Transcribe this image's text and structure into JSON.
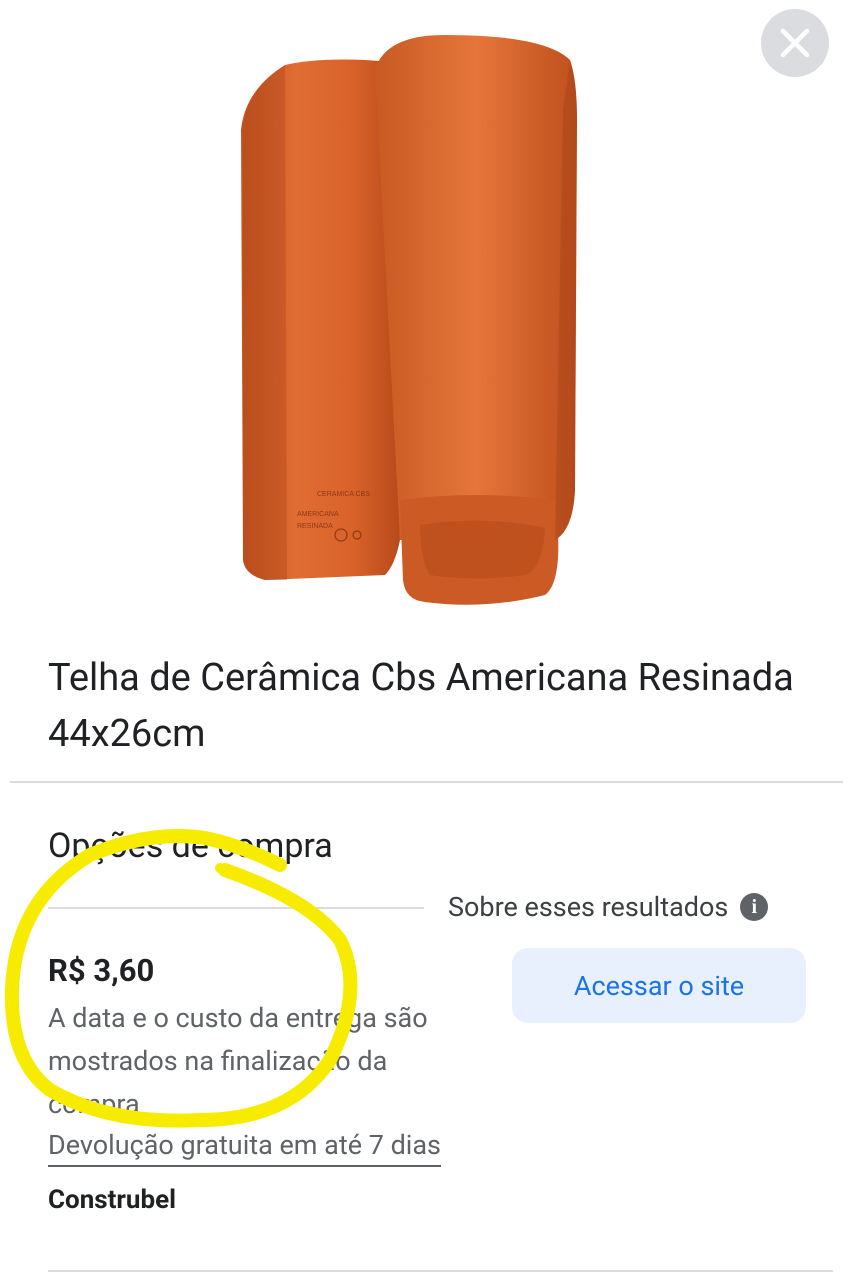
{
  "icons": {
    "close": "close-icon",
    "info": "info-icon"
  },
  "colors": {
    "accent": "#1a73e8",
    "button_bg": "#e8f0fe",
    "tile": "#d4612a",
    "highlight": "#f7ec00"
  },
  "product": {
    "title": "Telha de Cerâmica Cbs Americana Resinada 44x26cm",
    "image_stamp_lines": [
      "CERAMICA CBS",
      "AMERICANA",
      "RESINADA"
    ]
  },
  "purchase": {
    "section_title": "Opções de compra",
    "about_results": "Sobre esses resultados",
    "info_glyph": "i",
    "price": "R$ 3,60",
    "delivery_note": "A data e o custo da entrega são mostrados na finalização da compra",
    "returns": "Devolução gratuita em até 7 dias",
    "seller": "Construbel",
    "visit_button": "Acessar o site"
  }
}
